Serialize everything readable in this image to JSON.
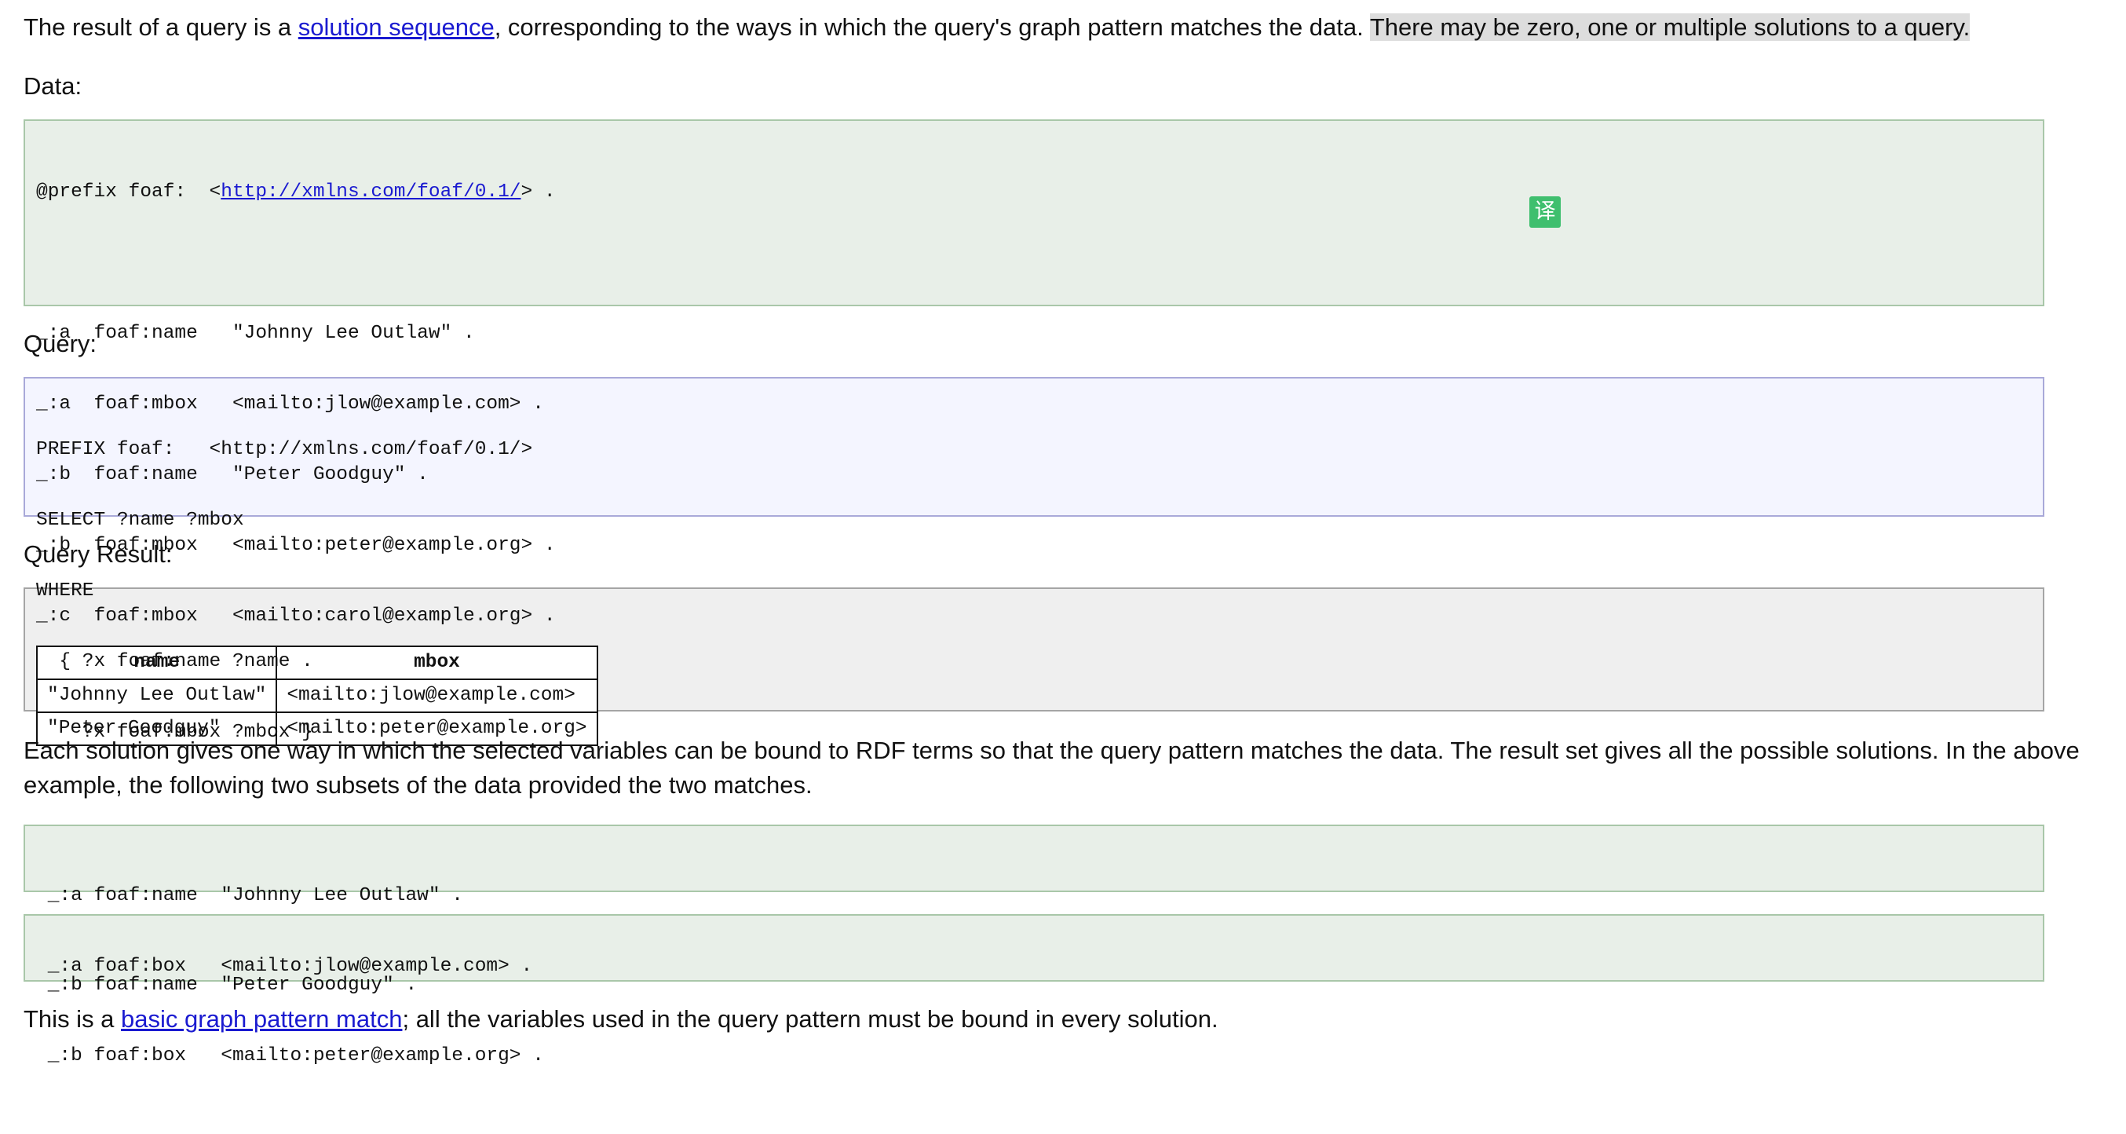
{
  "intro": {
    "before_link": "The result of a query is a ",
    "link": "solution sequence",
    "after_link": ", corresponding to the ways in which the query's graph pattern matches the data. ",
    "highlighted": "There may be zero, one or multiple solutions to a query."
  },
  "data_label": "Data:",
  "data_block": {
    "prefix_start": "@prefix foaf:  <",
    "prefix_link": "http://xmlns.com/foaf/0.1/",
    "prefix_end": "> .",
    "lines": [
      "_:a  foaf:name   \"Johnny Lee Outlaw\" .",
      "_:a  foaf:mbox   <mailto:jlow@example.com> .",
      "_:b  foaf:name   \"Peter Goodguy\" .",
      "_:b  foaf:mbox   <mailto:peter@example.org> .",
      "_:c  foaf:mbox   <mailto:carol@example.org> ."
    ]
  },
  "translate_icon": {
    "name": "translate-icon",
    "glyph": "译",
    "color": "#3fbf6e"
  },
  "query_label": "Query:",
  "query_lines": [
    "PREFIX foaf:   <http://xmlns.com/foaf/0.1/>",
    "SELECT ?name ?mbox",
    "WHERE",
    "  { ?x foaf:name ?name .",
    "    ?x foaf:mbox ?mbox }"
  ],
  "result_label": "Query Result:",
  "result_table": {
    "headers": [
      "name",
      "mbox"
    ],
    "rows": [
      [
        "\"Johnny Lee Outlaw\"",
        "<mailto:jlow@example.com>"
      ],
      [
        "\"Peter Goodguy\"",
        "<mailto:peter@example.org>"
      ]
    ]
  },
  "explanation": "Each solution gives one way in which the selected variables can be bound to RDF terms so that the query pattern matches the data. The result set gives all the possible solutions. In the above example, the following two subsets of the data provided the two matches.",
  "subset_a": [
    " _:a foaf:name  \"Johnny Lee Outlaw\" .",
    " _:a foaf:box   <mailto:jlow@example.com> ."
  ],
  "subset_b": [
    " _:b foaf:name  \"Peter Goodguy\" .",
    " _:b foaf:box   <mailto:peter@example.org> ."
  ],
  "footer": {
    "before_link": "This is a ",
    "link": "basic graph pattern match",
    "after_link": "; all the variables used in the query pattern must be bound in every solution."
  }
}
